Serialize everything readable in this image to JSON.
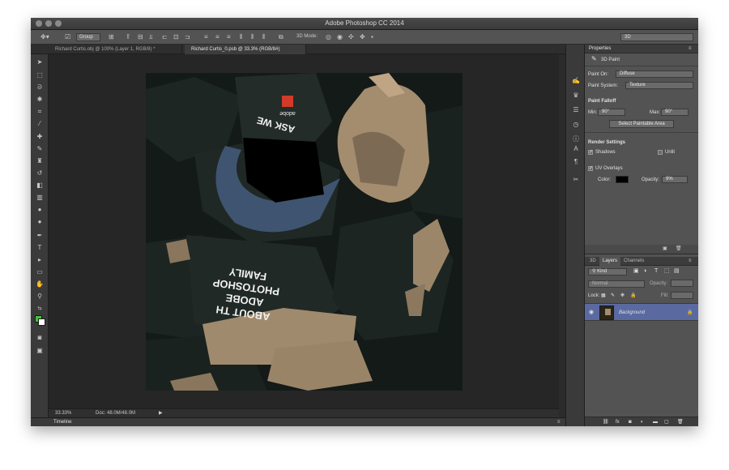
{
  "app": {
    "title": "Adobe Photoshop CC 2014"
  },
  "options_bar": {
    "auto_select_value": "Group",
    "mode_label": "3D Mode:",
    "workspace": "3D"
  },
  "doc_tabs": [
    {
      "label": "Richard Curtis.obj @ 100% (Layer 1, RGB/8) *"
    },
    {
      "label": "Richard Curtis_0.psb @ 33.3% (RGB/8#)"
    }
  ],
  "status": {
    "zoom": "33.33%",
    "doc_size": "Doc: 48.0M/48.0M"
  },
  "timeline_label": "Timeline",
  "canvas_text": {
    "ask_we": "ASK WE",
    "adobe": "adobe",
    "about_line1": "ABOUT TH",
    "about_line2": "ADOBE",
    "about_line3": "PHOTOSHOP",
    "about_line4": "FAMILY"
  },
  "properties": {
    "header": "Properties",
    "mode_title": "3D Paint",
    "paint_on_label": "Paint On:",
    "paint_on_value": "Diffuse",
    "paint_system_label": "Paint System:",
    "paint_system_value": "Texture",
    "falloff_title": "Paint Falloff",
    "min_label": "Min:",
    "min_value": "90°",
    "max_label": "Max:",
    "max_value": "90°",
    "select_paintable_button": "Select Paintable Area",
    "render_settings_title": "Render Settings",
    "shadows_label": "Shadows",
    "unlit_label": "Unlit",
    "uv_overlays_label": "UV Overlays",
    "color_label": "Color:",
    "opacity_label": "Opacity:",
    "opacity_value": "9%"
  },
  "layers_panel": {
    "tabs": [
      "3D",
      "Layers",
      "Channels"
    ],
    "filter_value": "Kind",
    "blend_mode": "Normal",
    "opacity_label": "Opacity:",
    "lock_label": "Lock:",
    "fill_label": "Fill:",
    "layers": [
      {
        "name": "Background"
      }
    ]
  },
  "colors": {
    "foreground": "#46c23c",
    "background": "#ffffff",
    "layer_selected": "#5a6aa0"
  }
}
